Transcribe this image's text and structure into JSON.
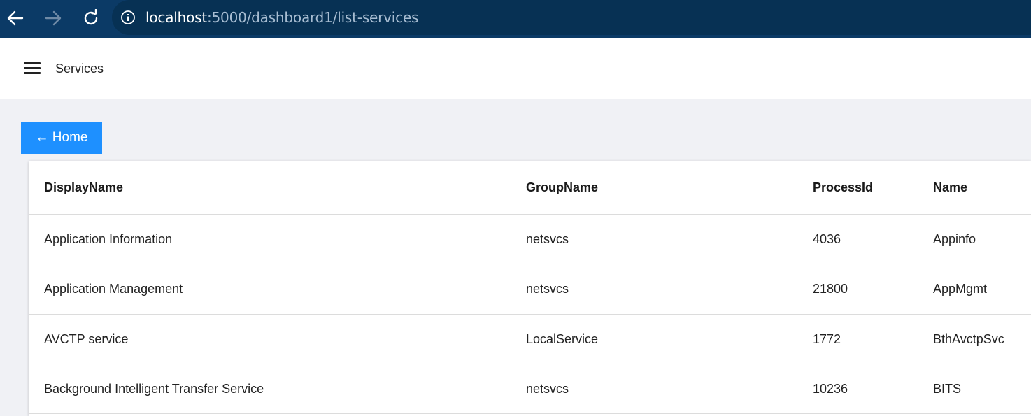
{
  "browser": {
    "url_host": "localhost",
    "url_rest": ":5000/dashboard1/list-services"
  },
  "header": {
    "title": "Services"
  },
  "home_button": {
    "label": "← Home"
  },
  "table": {
    "columns": [
      "DisplayName",
      "GroupName",
      "ProcessId",
      "Name"
    ],
    "rows": [
      [
        "Application Information",
        "netsvcs",
        "4036",
        "Appinfo"
      ],
      [
        "Application Management",
        "netsvcs",
        "21800",
        "AppMgmt"
      ],
      [
        "AVCTP service",
        "LocalService",
        "1772",
        "BthAvctpSvc"
      ],
      [
        "Background Intelligent Transfer Service",
        "netsvcs",
        "10236",
        "BITS"
      ]
    ]
  },
  "colors": {
    "browser_bar": "#0b3a66",
    "address_bar": "#073154",
    "accent": "#1e90ff",
    "background": "#f0f1f5"
  }
}
